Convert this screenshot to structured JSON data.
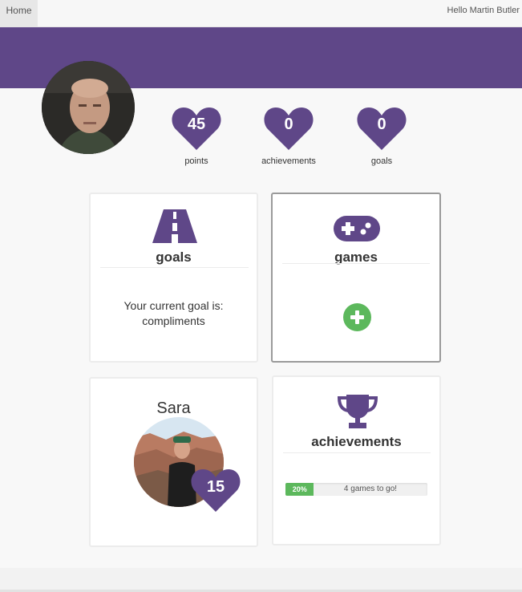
{
  "nav": {
    "home_label": "Home",
    "greeting": "Hello Martin Butler"
  },
  "colors": {
    "brand": "#5f4788",
    "success": "#5cb85c"
  },
  "profile": {
    "avatar_icon": "user-photo"
  },
  "stats": [
    {
      "value": "45",
      "label": "points"
    },
    {
      "value": "0",
      "label": "achievements"
    },
    {
      "value": "0",
      "label": "goals"
    }
  ],
  "goals_card": {
    "icon": "road-icon",
    "title": "goals",
    "line1": "Your current goal is:",
    "line2": "compliments"
  },
  "games_card": {
    "icon": "gamepad-icon",
    "title": "games",
    "add_icon": "plus-circle-icon"
  },
  "friend_card": {
    "name": "Sara",
    "points": "15"
  },
  "achievements_card": {
    "icon": "trophy-icon",
    "title": "achievements",
    "progress_percent": 20,
    "progress_label": "20%",
    "progress_text": "4 games to go!"
  }
}
